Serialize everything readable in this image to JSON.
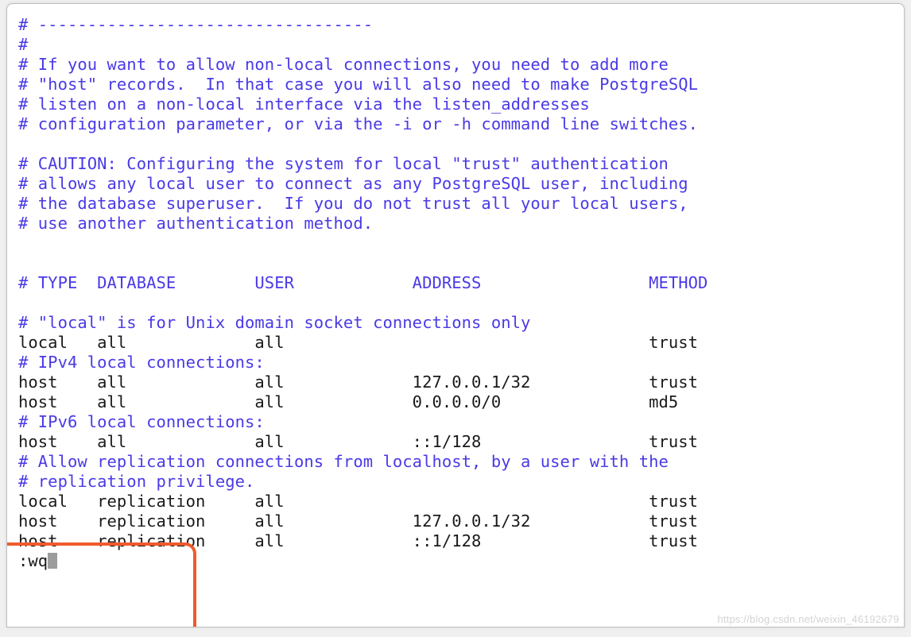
{
  "lines": [
    {
      "text": "# ----------------------------------",
      "cls": "comment"
    },
    {
      "text": "#",
      "cls": "comment"
    },
    {
      "text": "# If you want to allow non-local connections, you need to add more",
      "cls": "comment"
    },
    {
      "text": "# \"host\" records.  In that case you will also need to make PostgreSQL",
      "cls": "comment"
    },
    {
      "text": "# listen on a non-local interface via the listen_addresses",
      "cls": "comment"
    },
    {
      "text": "# configuration parameter, or via the -i or -h command line switches.",
      "cls": "comment"
    },
    {
      "text": "",
      "cls": "plain"
    },
    {
      "text": "# CAUTION: Configuring the system for local \"trust\" authentication",
      "cls": "comment"
    },
    {
      "text": "# allows any local user to connect as any PostgreSQL user, including",
      "cls": "comment"
    },
    {
      "text": "# the database superuser.  If you do not trust all your local users,",
      "cls": "comment"
    },
    {
      "text": "# use another authentication method.",
      "cls": "comment"
    },
    {
      "text": "",
      "cls": "plain"
    },
    {
      "text": "",
      "cls": "plain"
    },
    {
      "text": "# TYPE  DATABASE        USER            ADDRESS                 METHOD",
      "cls": "comment"
    },
    {
      "text": "",
      "cls": "plain"
    },
    {
      "text": "# \"local\" is for Unix domain socket connections only",
      "cls": "comment"
    },
    {
      "text": "local   all             all                                     trust",
      "cls": "plain"
    },
    {
      "text": "# IPv4 local connections:",
      "cls": "comment"
    },
    {
      "text": "host    all             all             127.0.0.1/32            trust",
      "cls": "plain"
    },
    {
      "text": "host    all             all             0.0.0.0/0               md5",
      "cls": "plain"
    },
    {
      "text": "# IPv6 local connections:",
      "cls": "comment"
    },
    {
      "text": "host    all             all             ::1/128                 trust",
      "cls": "plain"
    },
    {
      "text": "# Allow replication connections from localhost, by a user with the",
      "cls": "comment"
    },
    {
      "text": "# replication privilege.",
      "cls": "comment"
    },
    {
      "text": "local   replication     all                                     trust",
      "cls": "plain"
    },
    {
      "text": "host    replication     all             127.0.0.1/32            trust",
      "cls": "plain"
    },
    {
      "text": "host    replication     all             ::1/128                 trust",
      "cls": "plain"
    }
  ],
  "command_line": ":wq",
  "watermark": "https://blog.csdn.net/weixin_46192679"
}
